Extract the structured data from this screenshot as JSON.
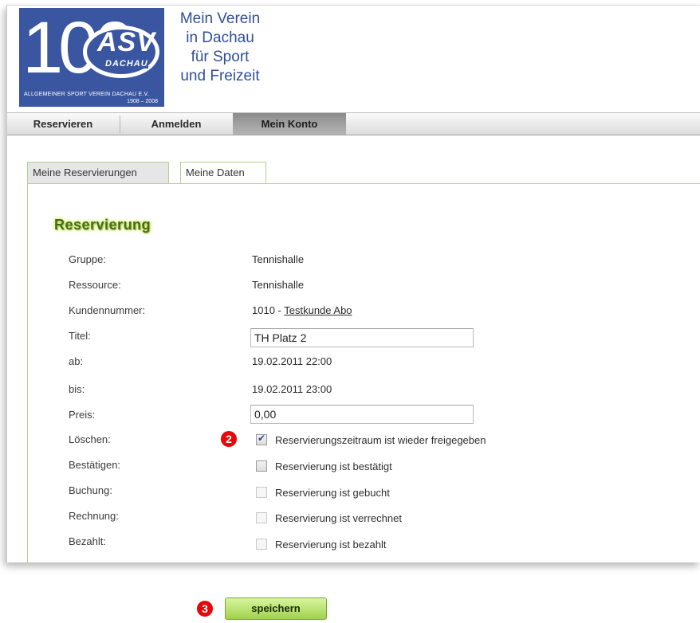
{
  "logo": {
    "number": "100",
    "brand": "ASV",
    "city": "DACHAU",
    "caption": "ALLGEMEINER SPORT VEREIN DACHAU E.V.",
    "years": "1908 – 2008"
  },
  "slogan": [
    "Mein Verein",
    "in Dachau",
    "für Sport",
    "und Freizeit"
  ],
  "nav": {
    "items": [
      {
        "label": "Reservieren",
        "active": false
      },
      {
        "label": "Anmelden",
        "active": false
      },
      {
        "label": "Mein Konto",
        "active": true
      }
    ]
  },
  "tabs": [
    {
      "label": "Meine Reservierungen",
      "active": true
    },
    {
      "label": "Meine Daten",
      "active": false
    }
  ],
  "section_title": "Reservierung",
  "fields": {
    "gruppe": {
      "label": "Gruppe:",
      "value": "Tennishalle"
    },
    "ressource": {
      "label": "Ressource:",
      "value": "Tennishalle"
    },
    "kundennummer": {
      "label": "Kundennummer:",
      "number": "1010",
      "separator": " - ",
      "link": "Testkunde Abo"
    },
    "titel": {
      "label": "Titel:",
      "value": "TH Platz 2"
    },
    "ab": {
      "label": "ab:",
      "value": "19.02.2011 22:00"
    },
    "bis": {
      "label": "bis:",
      "value": "19.02.2011 23:00"
    },
    "preis": {
      "label": "Preis:",
      "value": "0,00"
    }
  },
  "checkboxes": [
    {
      "label": "Löschen:",
      "text": "Reservierungszeitraum ist wieder freigegeben",
      "checked": true,
      "enabled": true
    },
    {
      "label": "Bestätigen:",
      "text": "Reservierung ist bestätigt",
      "checked": false,
      "enabled": true
    },
    {
      "label": "Buchung:",
      "text": "Reservierung ist gebucht",
      "checked": false,
      "enabled": false
    },
    {
      "label": "Rechnung:",
      "text": "Reservierung ist verrechnet",
      "checked": false,
      "enabled": false
    },
    {
      "label": "Bezahlt:",
      "text": "Reservierung ist bezahlt",
      "checked": false,
      "enabled": false
    }
  ],
  "markers": {
    "step2": "2",
    "step3": "3"
  },
  "save_button": "speichern",
  "colors": {
    "logo_blue": "#3a56a1",
    "slogan_blue": "#2f4f9a",
    "tab_border_green": "#b8cf8c",
    "button_green": "#9fd24a",
    "marker_red": "#e8060b"
  }
}
